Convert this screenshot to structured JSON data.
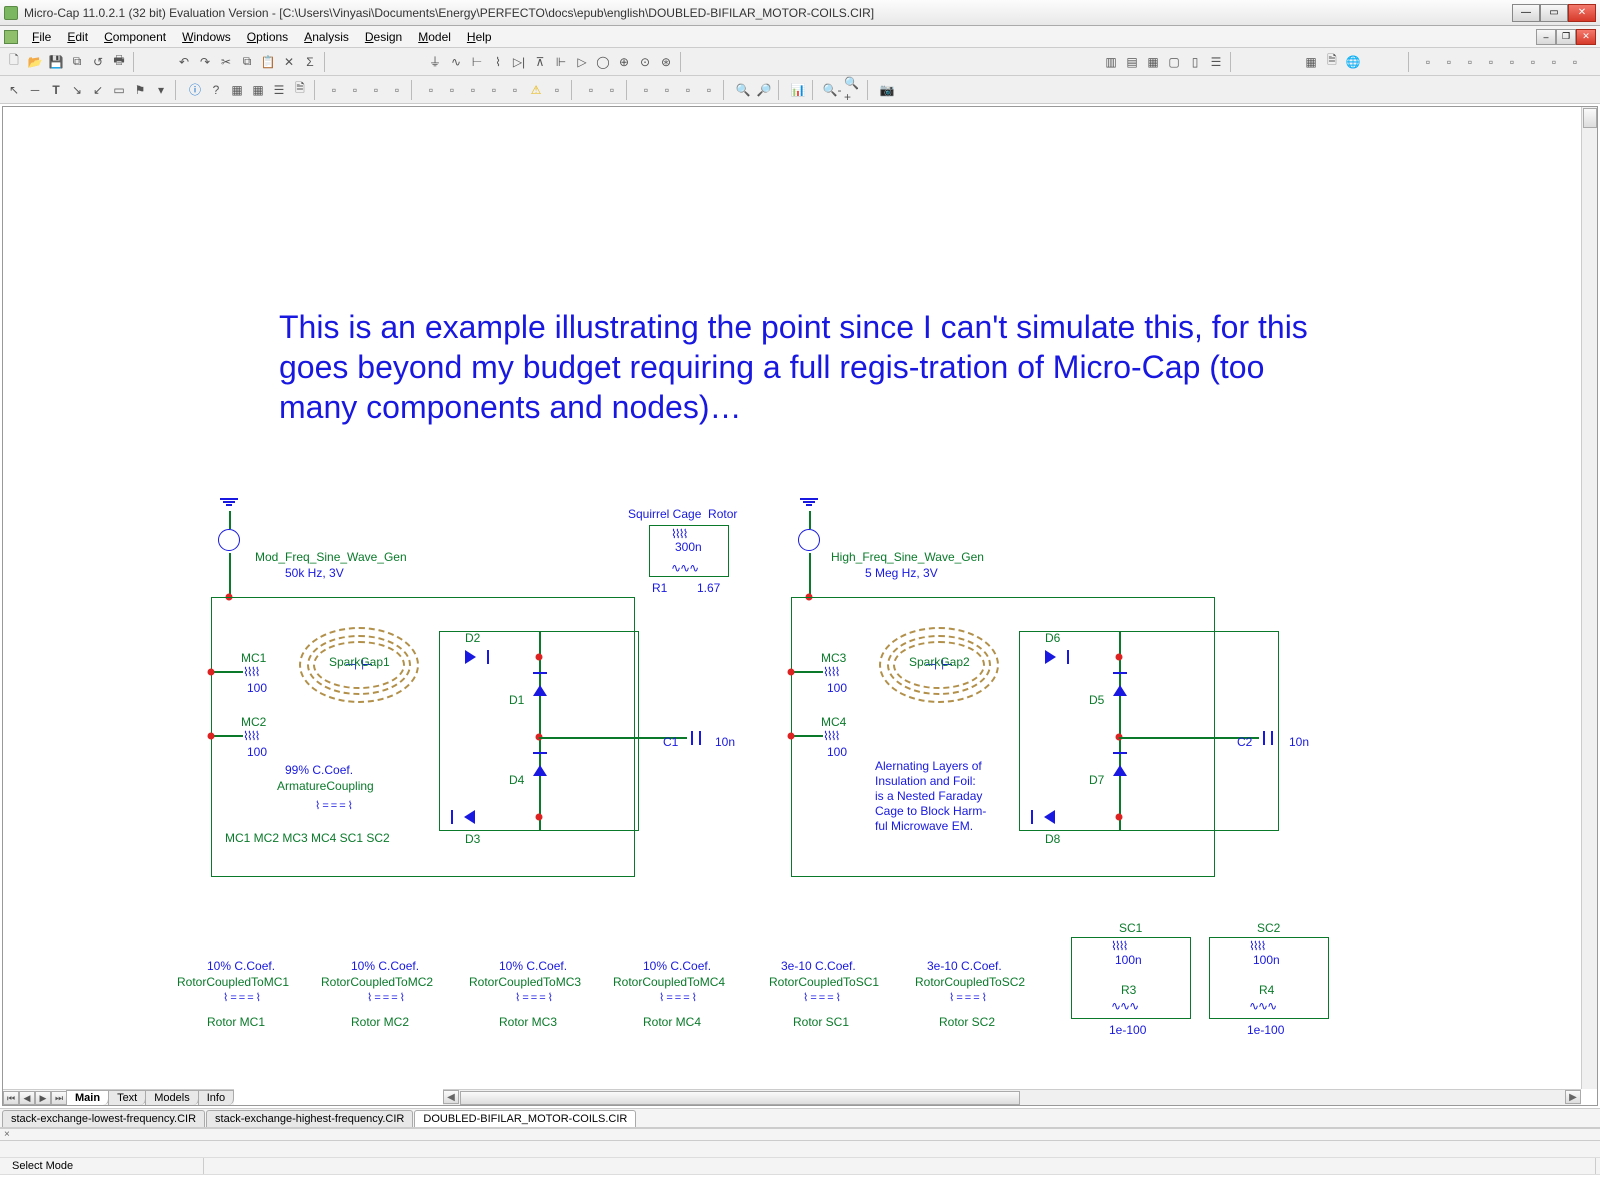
{
  "window": {
    "title": "Micro-Cap 11.0.2.1 (32 bit) Evaluation Version - [C:\\Users\\Vinyasi\\Documents\\Energy\\PERFECTO\\docs\\epub\\english\\DOUBLED-BIFILAR_MOTOR-COILS.CIR]"
  },
  "menu": {
    "file": "File",
    "edit": "Edit",
    "component": "Component",
    "windows": "Windows",
    "options": "Options",
    "analysis": "Analysis",
    "design": "Design",
    "model": "Model",
    "help": "Help"
  },
  "page_tabs": {
    "main": "Main",
    "text": "Text",
    "models": "Models",
    "info": "Info"
  },
  "file_tabs": {
    "t1": "stack-exchange-lowest-frequency.CIR",
    "t2": "stack-exchange-highest-frequency.CIR",
    "t3": "DOUBLED-BIFILAR_MOTOR-COILS.CIR"
  },
  "status": {
    "mode": "Select Mode"
  },
  "note": "This is an example illustrating the point since I can't simulate this, for this goes beyond my budget requiring a full regis-tration of Micro-Cap (too many components and nodes)…",
  "schem": {
    "rotor_title": "Squirrel Cage  Rotor",
    "rotor_L": "300n",
    "rotor_R_name": "R1",
    "rotor_R_val": "1.67",
    "gen1_name": "Mod_Freq_Sine_Wave_Gen",
    "gen1_sub": "50k Hz, 3V",
    "gen2_name": "High_Freq_Sine_Wave_Gen",
    "gen2_sub": "5 Meg Hz, 3V",
    "mc1": "MC1",
    "mc1v": "100",
    "mc2": "MC2",
    "mc2v": "100",
    "mc3": "MC3",
    "mc3v": "100",
    "mc4": "MC4",
    "mc4v": "100",
    "sg1": "SparkGap1",
    "sg2": "SparkGap2",
    "d1": "D1",
    "d2": "D2",
    "d3": "D3",
    "d4": "D4",
    "d5": "D5",
    "d6": "D6",
    "d7": "D7",
    "d8": "D8",
    "c1": "C1",
    "c1v": "10n",
    "c2": "C2",
    "c2v": "10n",
    "ccoef": "99% C.Coef.",
    "armcoup": "ArmatureCoupling",
    "armlist": "MC1 MC2 MC3 MC4 SC1 SC2",
    "altnote": "Alernating Layers of\nInsulation and Foil:\nis a Nested Faraday\nCage to Block Harm-\nful Microwave EM.",
    "rc_hdr_a": "10% C.Coef.",
    "rc_hdr_b": "3e-10 C.Coef.",
    "rc1": "RotorCoupledToMC1",
    "rc1b": "Rotor MC1",
    "rc2": "RotorCoupledToMC2",
    "rc2b": "Rotor MC2",
    "rc3": "RotorCoupledToMC3",
    "rc3b": "Rotor MC3",
    "rc4": "RotorCoupledToMC4",
    "rc4b": "Rotor MC4",
    "rs1": "RotorCoupledToSC1",
    "rs1b": "Rotor SC1",
    "rs2": "RotorCoupledToSC2",
    "rs2b": "Rotor SC2",
    "sc1": "SC1",
    "sc1L": "100n",
    "sc1R": "R3",
    "sc1Rv": "1e-100",
    "sc2": "SC2",
    "sc2L": "100n",
    "sc2R": "R4",
    "sc2Rv": "1e-100"
  }
}
